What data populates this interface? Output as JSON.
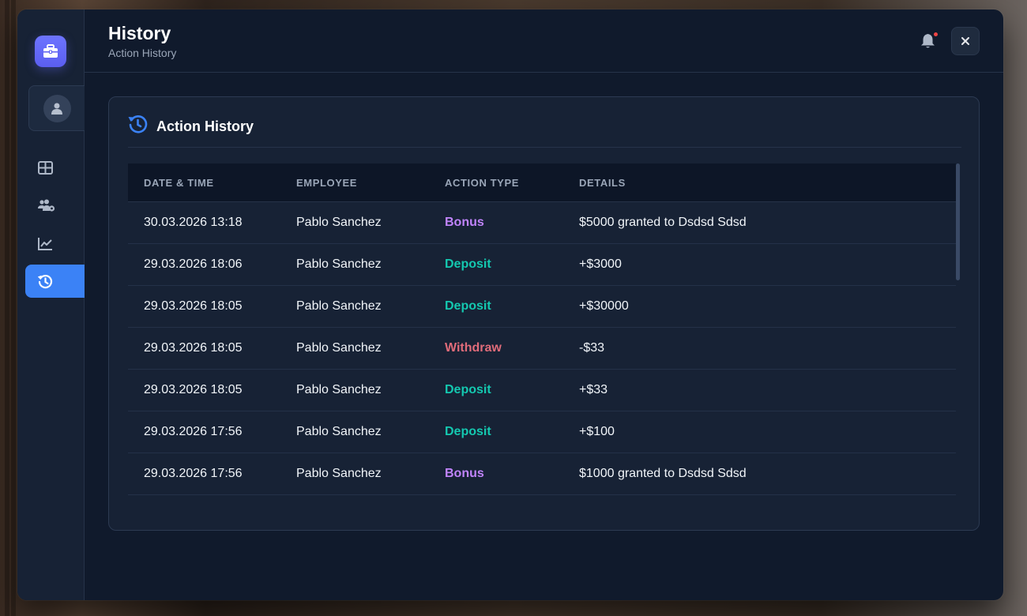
{
  "header": {
    "title": "History",
    "subtitle": "Action History"
  },
  "sidebar": {
    "items": [
      {
        "icon": "grid-icon",
        "label": "dashboard"
      },
      {
        "icon": "users-gear-icon",
        "label": "employees"
      },
      {
        "icon": "chart-line-icon",
        "label": "statistics"
      },
      {
        "icon": "history-icon",
        "label": "history",
        "active": true
      }
    ]
  },
  "card": {
    "title": "Action History"
  },
  "table": {
    "columns": [
      "DATE & TIME",
      "EMPLOYEE",
      "ACTION TYPE",
      "DETAILS"
    ],
    "rows": [
      {
        "datetime": "30.03.2026 13:18",
        "employee": "Pablo Sanchez",
        "action": "Bonus",
        "details": "$5000 granted to Dsdsd Sdsd"
      },
      {
        "datetime": "29.03.2026 18:06",
        "employee": "Pablo Sanchez",
        "action": "Deposit",
        "details": "+$3000"
      },
      {
        "datetime": "29.03.2026 18:05",
        "employee": "Pablo Sanchez",
        "action": "Deposit",
        "details": "+$30000"
      },
      {
        "datetime": "29.03.2026 18:05",
        "employee": "Pablo Sanchez",
        "action": "Withdraw",
        "details": "-$33"
      },
      {
        "datetime": "29.03.2026 18:05",
        "employee": "Pablo Sanchez",
        "action": "Deposit",
        "details": "+$33"
      },
      {
        "datetime": "29.03.2026 17:56",
        "employee": "Pablo Sanchez",
        "action": "Deposit",
        "details": "+$100"
      },
      {
        "datetime": "29.03.2026 17:56",
        "employee": "Pablo Sanchez",
        "action": "Bonus",
        "details": "$1000 granted to Dsdsd Sdsd"
      }
    ]
  },
  "colors": {
    "accent": "#3b82f6",
    "bonus": "#c084fc",
    "deposit": "#14c8b0",
    "withdraw": "#e06c7a"
  }
}
